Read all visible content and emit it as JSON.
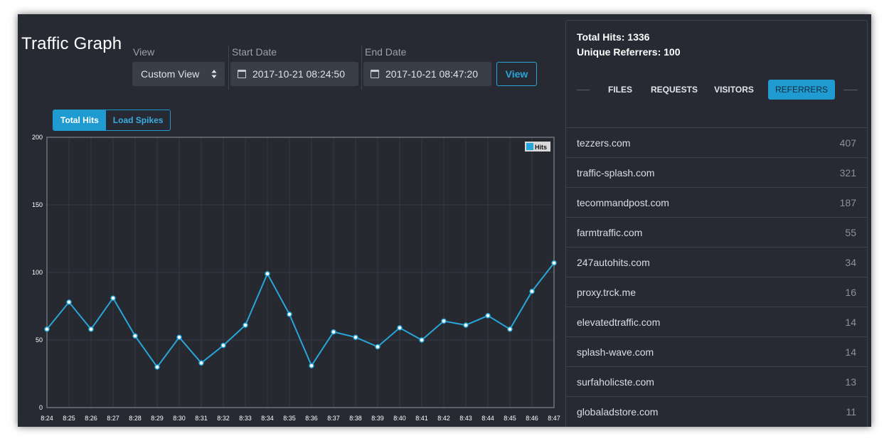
{
  "header": {
    "title": "Traffic Graph"
  },
  "filters": {
    "view_label": "View",
    "view_value": "Custom View",
    "start_label": "Start Date",
    "start_value": "2017-10-21 08:24:50",
    "end_label": "End Date",
    "end_value": "2017-10-21 08:47:20",
    "view_button": "View"
  },
  "chart_tabs": {
    "total_hits": "Total Hits",
    "load_spikes": "Load Spikes",
    "active": "Total Hits"
  },
  "chart_data": {
    "type": "line",
    "categories": [
      "8:24",
      "8:25",
      "8:26",
      "8:27",
      "8:28",
      "8:29",
      "8:30",
      "8:31",
      "8:32",
      "8:33",
      "8:34",
      "8:35",
      "8:36",
      "8:37",
      "8:38",
      "8:39",
      "8:40",
      "8:41",
      "8:42",
      "8:43",
      "8:44",
      "8:45",
      "8:46",
      "8:47"
    ],
    "series": [
      {
        "name": "Hits",
        "values": [
          58,
          78,
          58,
          81,
          53,
          30,
          52,
          33,
          46,
          61,
          99,
          69,
          31,
          56,
          52,
          45,
          59,
          50,
          64,
          61,
          68,
          58,
          86,
          107
        ]
      }
    ],
    "ylim": [
      0,
      200
    ],
    "yticks": [
      0,
      50,
      100,
      150,
      200
    ],
    "grid": true,
    "legend": "top-right",
    "colors": {
      "line": "#29a6d9",
      "grid": "#353944",
      "axis": "#6f737b",
      "tick": "#ffffff"
    }
  },
  "summary": {
    "total_hits": "Total Hits: 1336",
    "unique_referrers": "Unique Referrers: 100"
  },
  "tabs": [
    "FILES",
    "REQUESTS",
    "VISITORS",
    "REFERRERS"
  ],
  "active_tab": "REFERRERS",
  "referrers": [
    {
      "name": "tezzers.com",
      "count": "407"
    },
    {
      "name": "traffic-splash.com",
      "count": "321"
    },
    {
      "name": "tecommandpost.com",
      "count": "187"
    },
    {
      "name": "farmtraffic.com",
      "count": "55"
    },
    {
      "name": "247autohits.com",
      "count": "34"
    },
    {
      "name": "proxy.trck.me",
      "count": "16"
    },
    {
      "name": "elevatedtraffic.com",
      "count": "14"
    },
    {
      "name": "splash-wave.com",
      "count": "14"
    },
    {
      "name": "surfaholicste.com",
      "count": "13"
    },
    {
      "name": "globaladstore.com",
      "count": "11"
    }
  ],
  "theme": {
    "accent": "#1f9bd1",
    "background": "#272a33"
  }
}
